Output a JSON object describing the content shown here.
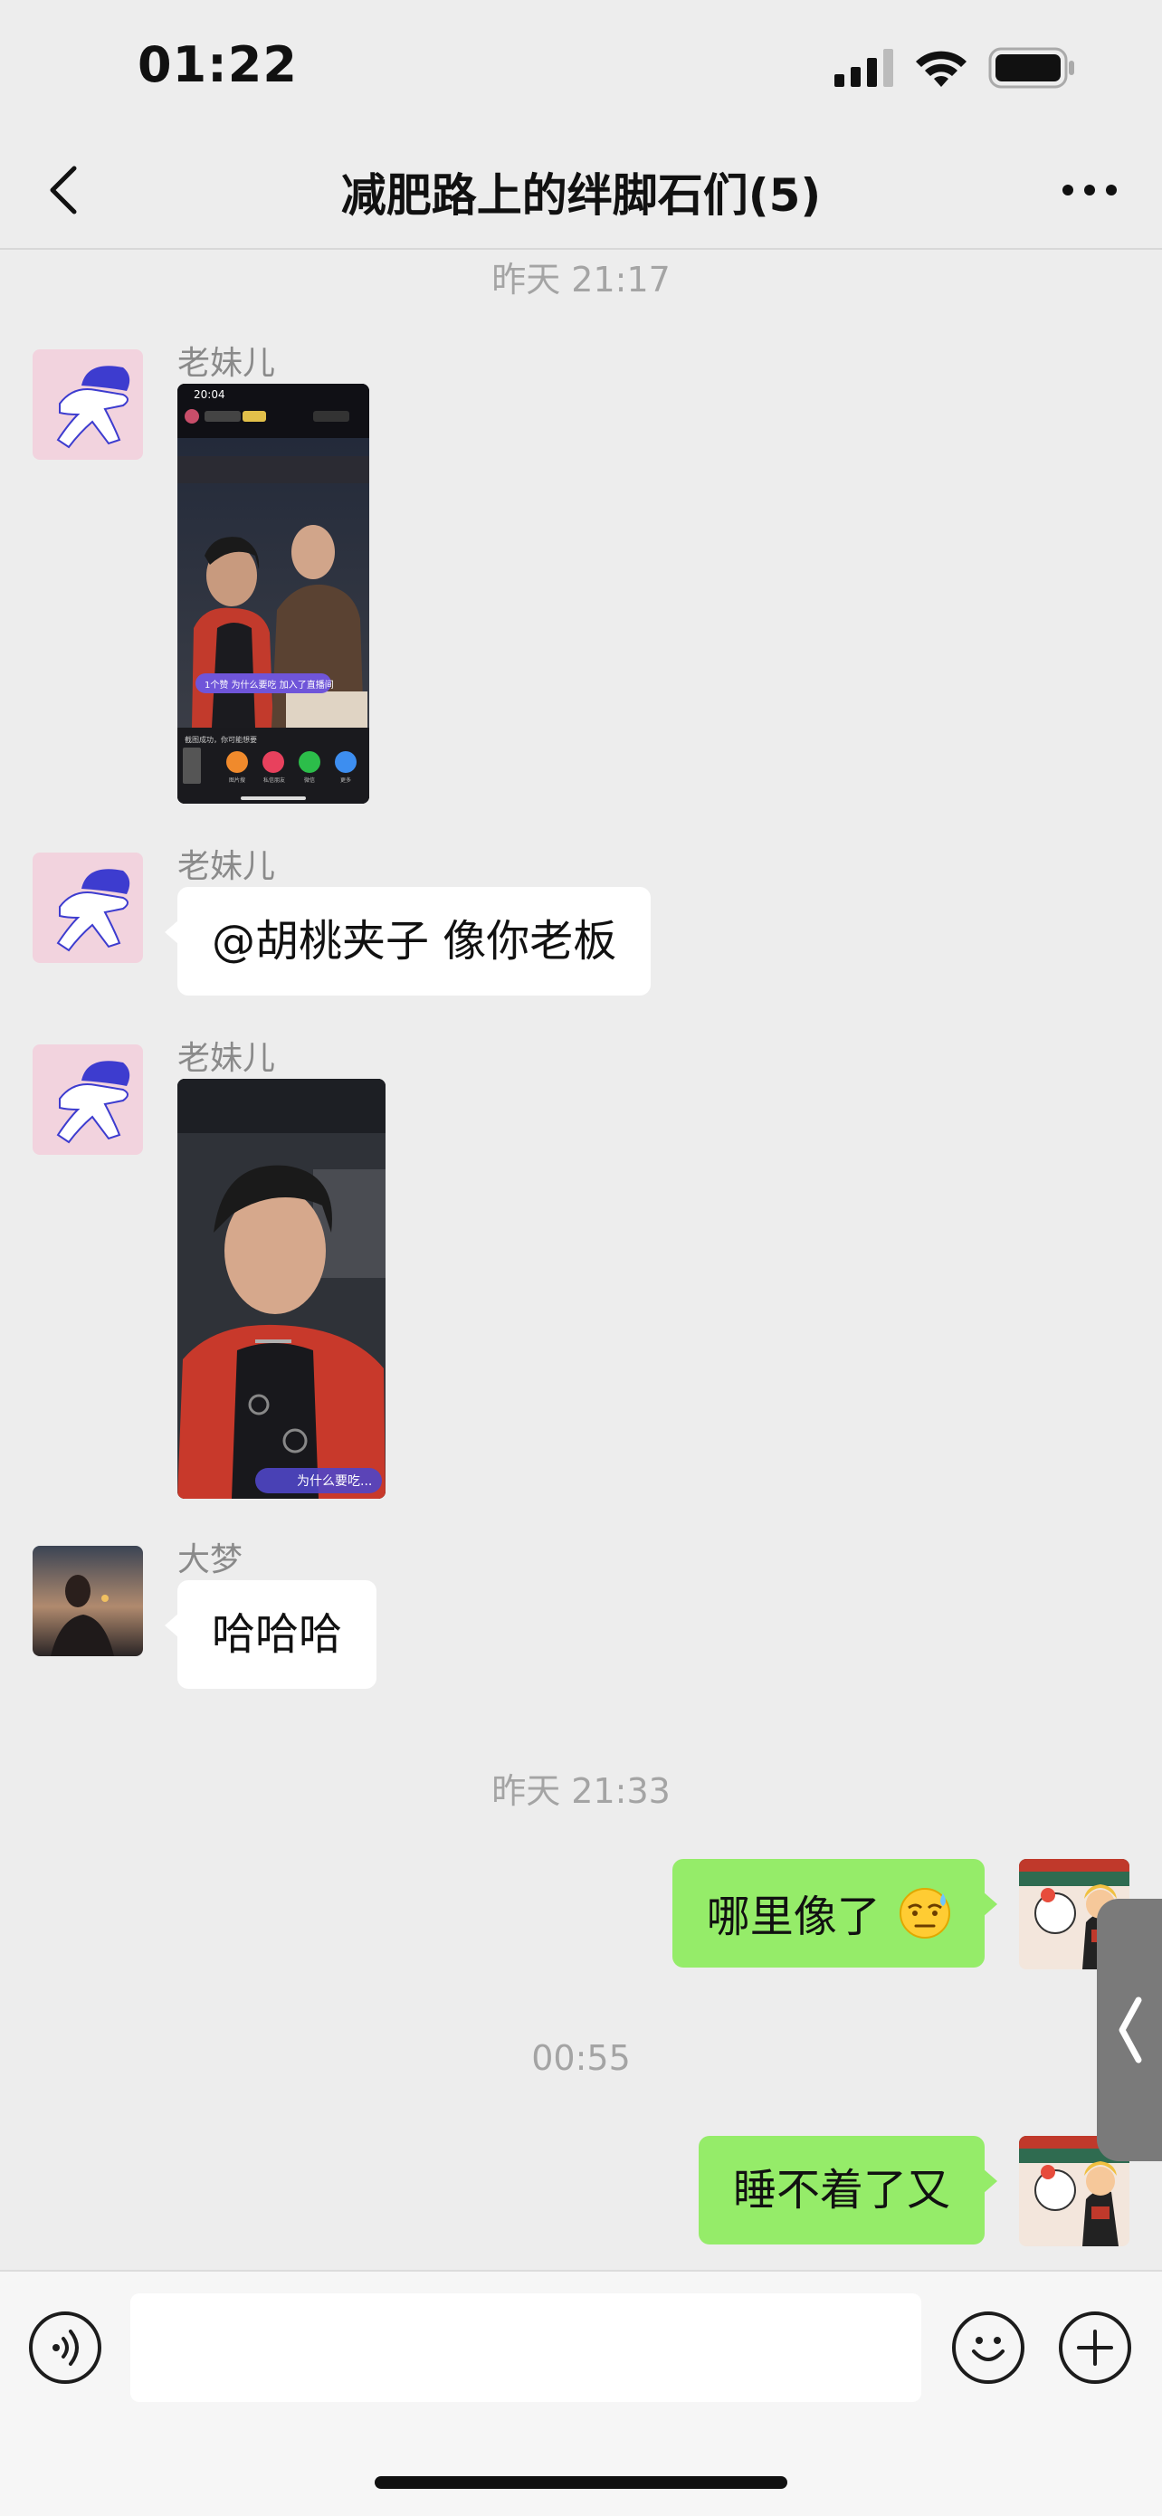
{
  "status_bar": {
    "time": "01:22"
  },
  "header": {
    "title": "减肥路上的绊脚石们(5)"
  },
  "dividers": {
    "d1": "昨天 21:17",
    "d2": "昨天 21:33",
    "d3": "00:55"
  },
  "messages": {
    "m1": {
      "sender": "老妹儿"
    },
    "m2": {
      "sender": "老妹儿",
      "text": "@胡桃夹子 像你老板"
    },
    "m3": {
      "sender": "老妹儿",
      "caption": "为什么要吃..."
    },
    "m4": {
      "sender": "大梦",
      "text": "哈哈哈"
    },
    "m5": {
      "text": "哪里像了"
    },
    "m6": {
      "text": "睡不着了又"
    }
  },
  "screenshot": {
    "time": "20:04",
    "banner": "1个赞 为什么要吃 加入了直播间",
    "share_title": "截图成功，你可能想要",
    "share_labels": [
      "图片搜",
      "私信朋友",
      "微信",
      "更多"
    ]
  },
  "colors": {
    "bg": "#ededed",
    "incoming_bubble": "#ffffff",
    "outgoing_bubble": "#95ec69",
    "meta_text": "#a4a4a4",
    "avatar_bg": "#f2d3de",
    "brand_blue": "#3d3ccf"
  },
  "icons": [
    "back-icon",
    "more-icon",
    "voice-icon",
    "emoji-icon",
    "add-icon",
    "signal-icon",
    "wifi-icon",
    "battery-icon"
  ]
}
